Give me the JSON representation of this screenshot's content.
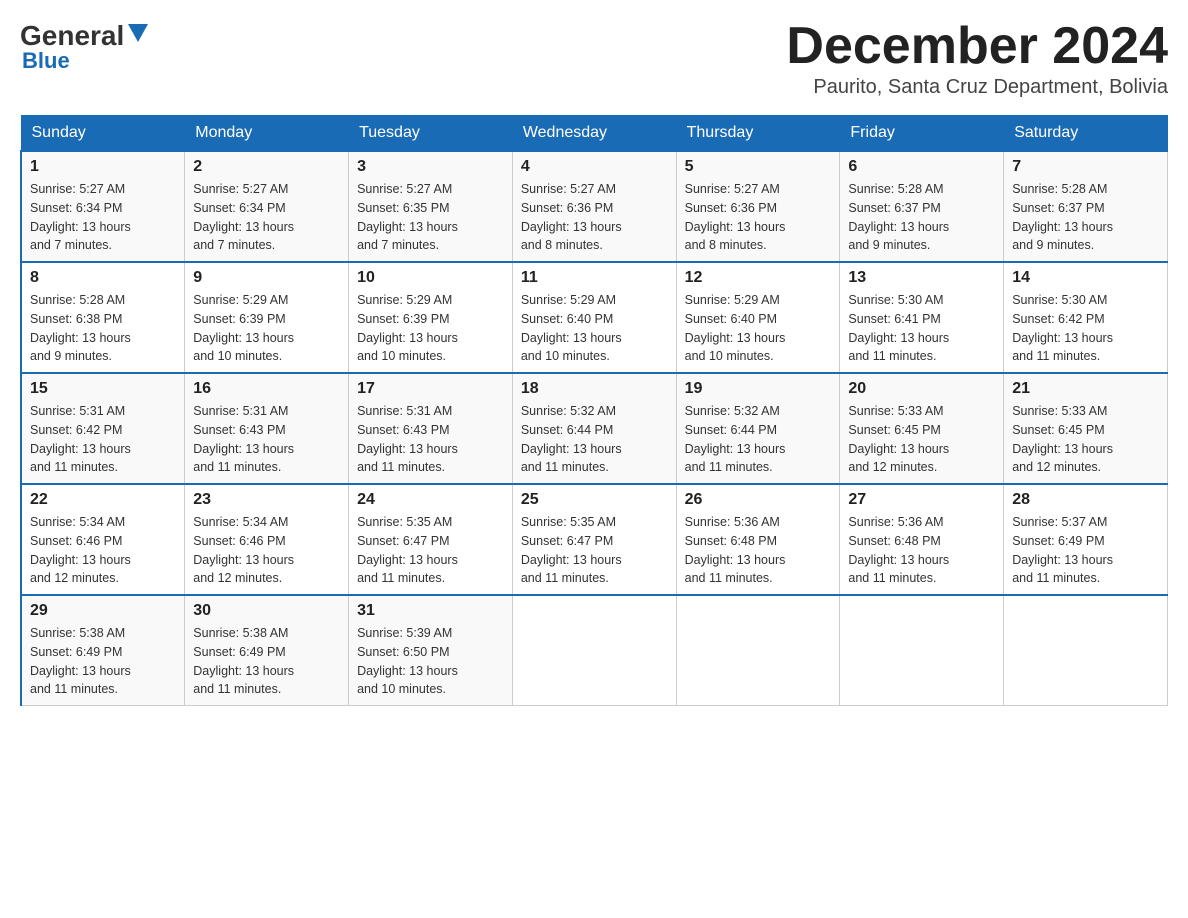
{
  "logo": {
    "general": "General",
    "blue": "Blue"
  },
  "header": {
    "month": "December 2024",
    "location": "Paurito, Santa Cruz Department, Bolivia"
  },
  "weekdays": [
    "Sunday",
    "Monday",
    "Tuesday",
    "Wednesday",
    "Thursday",
    "Friday",
    "Saturday"
  ],
  "rows": [
    [
      {
        "day": "1",
        "sunrise": "5:27 AM",
        "sunset": "6:34 PM",
        "daylight": "13 hours and 7 minutes."
      },
      {
        "day": "2",
        "sunrise": "5:27 AM",
        "sunset": "6:34 PM",
        "daylight": "13 hours and 7 minutes."
      },
      {
        "day": "3",
        "sunrise": "5:27 AM",
        "sunset": "6:35 PM",
        "daylight": "13 hours and 7 minutes."
      },
      {
        "day": "4",
        "sunrise": "5:27 AM",
        "sunset": "6:36 PM",
        "daylight": "13 hours and 8 minutes."
      },
      {
        "day": "5",
        "sunrise": "5:27 AM",
        "sunset": "6:36 PM",
        "daylight": "13 hours and 8 minutes."
      },
      {
        "day": "6",
        "sunrise": "5:28 AM",
        "sunset": "6:37 PM",
        "daylight": "13 hours and 9 minutes."
      },
      {
        "day": "7",
        "sunrise": "5:28 AM",
        "sunset": "6:37 PM",
        "daylight": "13 hours and 9 minutes."
      }
    ],
    [
      {
        "day": "8",
        "sunrise": "5:28 AM",
        "sunset": "6:38 PM",
        "daylight": "13 hours and 9 minutes."
      },
      {
        "day": "9",
        "sunrise": "5:29 AM",
        "sunset": "6:39 PM",
        "daylight": "13 hours and 10 minutes."
      },
      {
        "day": "10",
        "sunrise": "5:29 AM",
        "sunset": "6:39 PM",
        "daylight": "13 hours and 10 minutes."
      },
      {
        "day": "11",
        "sunrise": "5:29 AM",
        "sunset": "6:40 PM",
        "daylight": "13 hours and 10 minutes."
      },
      {
        "day": "12",
        "sunrise": "5:29 AM",
        "sunset": "6:40 PM",
        "daylight": "13 hours and 10 minutes."
      },
      {
        "day": "13",
        "sunrise": "5:30 AM",
        "sunset": "6:41 PM",
        "daylight": "13 hours and 11 minutes."
      },
      {
        "day": "14",
        "sunrise": "5:30 AM",
        "sunset": "6:42 PM",
        "daylight": "13 hours and 11 minutes."
      }
    ],
    [
      {
        "day": "15",
        "sunrise": "5:31 AM",
        "sunset": "6:42 PM",
        "daylight": "13 hours and 11 minutes."
      },
      {
        "day": "16",
        "sunrise": "5:31 AM",
        "sunset": "6:43 PM",
        "daylight": "13 hours and 11 minutes."
      },
      {
        "day": "17",
        "sunrise": "5:31 AM",
        "sunset": "6:43 PM",
        "daylight": "13 hours and 11 minutes."
      },
      {
        "day": "18",
        "sunrise": "5:32 AM",
        "sunset": "6:44 PM",
        "daylight": "13 hours and 11 minutes."
      },
      {
        "day": "19",
        "sunrise": "5:32 AM",
        "sunset": "6:44 PM",
        "daylight": "13 hours and 11 minutes."
      },
      {
        "day": "20",
        "sunrise": "5:33 AM",
        "sunset": "6:45 PM",
        "daylight": "13 hours and 12 minutes."
      },
      {
        "day": "21",
        "sunrise": "5:33 AM",
        "sunset": "6:45 PM",
        "daylight": "13 hours and 12 minutes."
      }
    ],
    [
      {
        "day": "22",
        "sunrise": "5:34 AM",
        "sunset": "6:46 PM",
        "daylight": "13 hours and 12 minutes."
      },
      {
        "day": "23",
        "sunrise": "5:34 AM",
        "sunset": "6:46 PM",
        "daylight": "13 hours and 12 minutes."
      },
      {
        "day": "24",
        "sunrise": "5:35 AM",
        "sunset": "6:47 PM",
        "daylight": "13 hours and 11 minutes."
      },
      {
        "day": "25",
        "sunrise": "5:35 AM",
        "sunset": "6:47 PM",
        "daylight": "13 hours and 11 minutes."
      },
      {
        "day": "26",
        "sunrise": "5:36 AM",
        "sunset": "6:48 PM",
        "daylight": "13 hours and 11 minutes."
      },
      {
        "day": "27",
        "sunrise": "5:36 AM",
        "sunset": "6:48 PM",
        "daylight": "13 hours and 11 minutes."
      },
      {
        "day": "28",
        "sunrise": "5:37 AM",
        "sunset": "6:49 PM",
        "daylight": "13 hours and 11 minutes."
      }
    ],
    [
      {
        "day": "29",
        "sunrise": "5:38 AM",
        "sunset": "6:49 PM",
        "daylight": "13 hours and 11 minutes."
      },
      {
        "day": "30",
        "sunrise": "5:38 AM",
        "sunset": "6:49 PM",
        "daylight": "13 hours and 11 minutes."
      },
      {
        "day": "31",
        "sunrise": "5:39 AM",
        "sunset": "6:50 PM",
        "daylight": "13 hours and 10 minutes."
      },
      null,
      null,
      null,
      null
    ]
  ],
  "labels": {
    "sunrise": "Sunrise:",
    "sunset": "Sunset:",
    "daylight": "Daylight:"
  }
}
